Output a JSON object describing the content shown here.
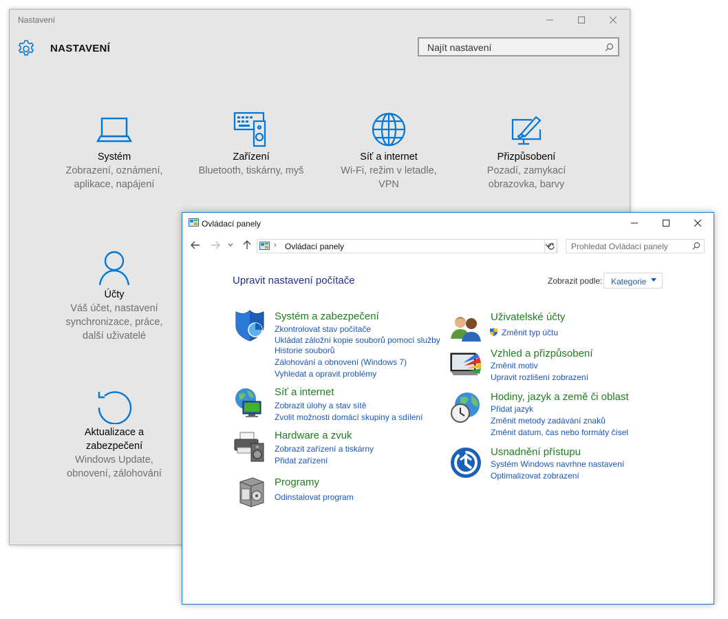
{
  "settings": {
    "window_title": "Nastavení",
    "heading": "NASTAVENÍ",
    "search_placeholder": "Najít nastavení",
    "tiles": [
      {
        "name": "Systém",
        "desc1": "Zobrazení, oznámení,",
        "desc2": "aplikace, napájení",
        "desc3": ""
      },
      {
        "name": "Zařízení",
        "desc1": "Bluetooth, tiskárny, myš",
        "desc2": "",
        "desc3": ""
      },
      {
        "name": "Síť a internet",
        "desc1": "Wi-Fi, režim v letadle,",
        "desc2": "VPN",
        "desc3": ""
      },
      {
        "name": "Přizpůsobení",
        "desc1": "Pozadí, zamykací",
        "desc2": "obrazovka, barvy",
        "desc3": ""
      },
      {
        "name": "Účty",
        "desc1": "Váš účet, nastavení",
        "desc2": "synchronizace, práce,",
        "desc3": "další uživatelé"
      },
      {
        "name": "Aktualizace a",
        "name2": "zabezpečení",
        "desc1": "Windows Update,",
        "desc2": "obnovení, zálohování",
        "desc3": ""
      }
    ]
  },
  "control_panel": {
    "window_title": "Ovládací panely",
    "address_path": "Ovládací panely",
    "search_placeholder": "Prohledat Ovládací panely",
    "heading": "Upravit nastavení počítače",
    "view_by_label": "Zobrazit podle:",
    "view_by_value": "Kategorie",
    "left": [
      {
        "title": "Systém a zabezpečení",
        "links": [
          "Zkontrolovat stav počítače",
          "Ukládat záložní kopie souborů pomocí služby",
          "Historie souborů",
          "Zálohování a obnovení (Windows 7)",
          "Vyhledat a opravit problémy"
        ]
      },
      {
        "title": "Síť a internet",
        "links": [
          "Zobrazit úlohy a stav sítě",
          "Zvolit možnosti domácí skupiny a sdílení"
        ]
      },
      {
        "title": "Hardware a zvuk",
        "links": [
          "Zobrazit zařízení a tiskárny",
          "Přidat zařízení"
        ]
      },
      {
        "title": "Programy",
        "links": [
          "Odinstalovat program"
        ]
      }
    ],
    "right": [
      {
        "title": "Uživatelské účty",
        "links": [
          "Změnit typ účtu"
        ]
      },
      {
        "title": "Vzhled a přizpůsobení",
        "links": [
          "Změnit motiv",
          "Upravit rozlišení zobrazení"
        ]
      },
      {
        "title": "Hodiny, jazyk a země či oblast",
        "links": [
          "Přidat jazyk",
          "Změnit metody zadávání znaků",
          "Změnit datum, čas nebo formáty čísel"
        ]
      },
      {
        "title": "Usnadnění přístupu",
        "links": [
          "Systém Windows navrhne nastavení",
          "Optimalizovat zobrazení"
        ]
      }
    ]
  },
  "colors": {
    "accent": "#0078d7",
    "cp_green": "#1e7d1e",
    "cp_link": "#1a56b8",
    "cp_heading": "#1e3287"
  }
}
